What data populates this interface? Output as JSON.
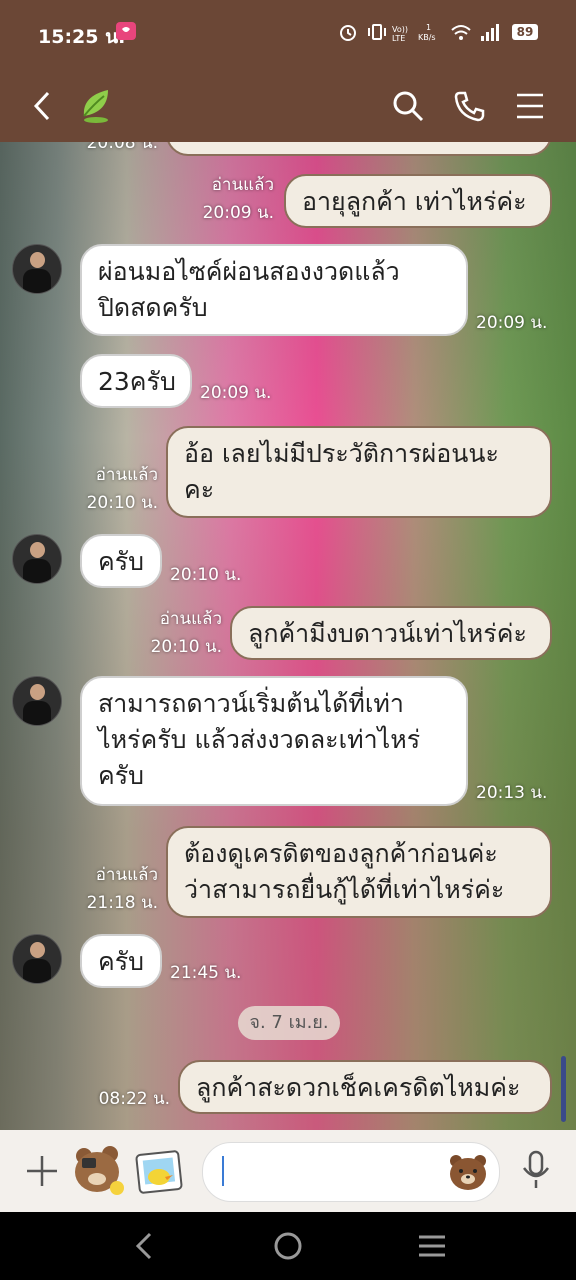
{
  "status_bar": {
    "time": "15:25 น.",
    "battery": "89"
  },
  "header": {
    "colors": {
      "bar": "#6b4736"
    }
  },
  "messages": [
    {
      "dir": "out",
      "text": "",
      "read": "",
      "time": "20:08 น."
    },
    {
      "dir": "out",
      "text": "อายุลูกค้า เท่าไหร่ค่ะ",
      "read": "อ่านแล้ว",
      "time": "20:09 น."
    },
    {
      "dir": "in",
      "lines": [
        "ผ่อนมอไซค์ผ่อนสองงวดแล้ว",
        "ปิดสดครับ"
      ],
      "time": "20:09 น."
    },
    {
      "dir": "in",
      "text": "23ครับ",
      "time": "20:09 น."
    },
    {
      "dir": "out",
      "lines": [
        "อ้อ เลยไม่มีประวัติการผ่อนนะ",
        "คะ"
      ],
      "read": "อ่านแล้ว",
      "time": "20:10 น."
    },
    {
      "dir": "in",
      "text": "ครับ",
      "time": "20:10 น."
    },
    {
      "dir": "out",
      "text": "ลูกค้ามีงบดาวน์เท่าไหร่ค่ะ",
      "read": "อ่านแล้ว",
      "time": "20:10 น."
    },
    {
      "dir": "in",
      "lines": [
        "สามารถดาวน์เริ่มต้นได้ที่เท่า",
        "ไหร่ครับ แล้วส่งงวดละเท่าไหร่",
        "ครับ"
      ],
      "time": "20:13 น."
    },
    {
      "dir": "out",
      "lines": [
        "ต้องดูเครดิตของลูกค้าก่อนค่ะ",
        "ว่าสามารถยื่นกู้ได้ที่เท่าไหร่ค่ะ"
      ],
      "read": "อ่านแล้ว",
      "time": "21:18 น."
    },
    {
      "dir": "in",
      "text": "ครับ",
      "time": "21:45 น."
    },
    {
      "dir": "out",
      "text": "ลูกค้าสะดวกเช็คเครดิตไหมค่ะ",
      "read": "",
      "time": "08:22 น."
    }
  ],
  "date_separator": "จ. 7 เม.ย.",
  "input": {
    "placeholder": ""
  }
}
